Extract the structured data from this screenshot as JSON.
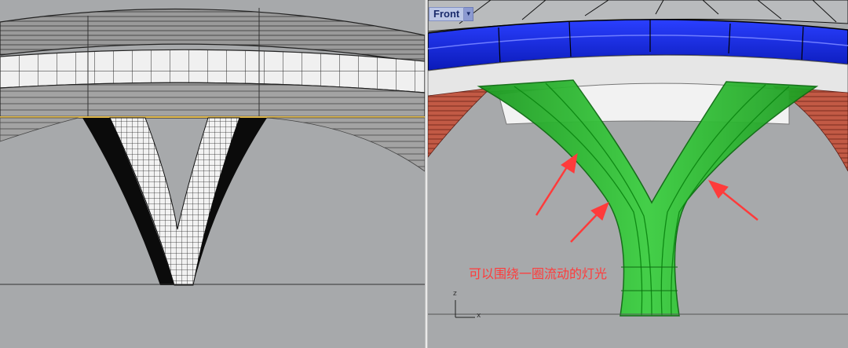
{
  "viewports": {
    "left": {
      "name": ""
    },
    "right": {
      "name": "Front",
      "dropdown_icon": "chevron-down-icon"
    }
  },
  "annotation": {
    "text": "可以围绕一圈流动的灯光",
    "color": "#ff3b3b",
    "arrow_count": 3
  },
  "axes": {
    "z_label": "z",
    "x_label": "x"
  },
  "colors": {
    "viewport_bg": "#a7a9ab",
    "blue_ring": "#1226d8",
    "green_column": "#22b326",
    "brick_red": "#c25a45"
  }
}
